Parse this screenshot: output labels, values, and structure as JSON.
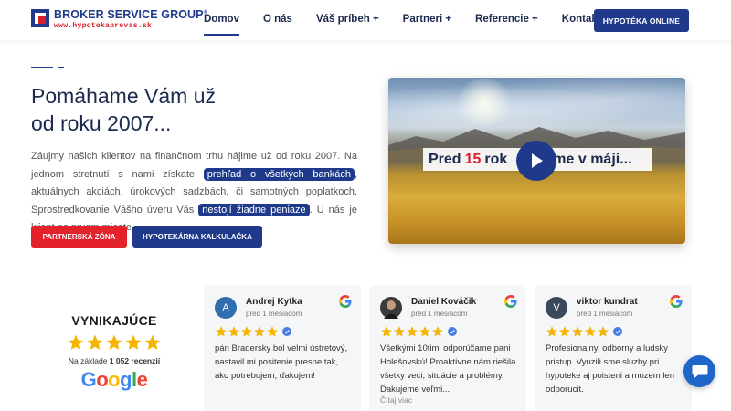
{
  "header": {
    "logo_title": "BROKER SERVICE GROUP",
    "logo_reg": "®",
    "logo_url": "www.hypotekaprevas.sk",
    "nav": [
      {
        "label": "Domov",
        "active": true
      },
      {
        "label": "O nás",
        "active": false
      },
      {
        "label": "Váš príbeh +",
        "active": false
      },
      {
        "label": "Partneri +",
        "active": false
      },
      {
        "label": "Referencie +",
        "active": false
      },
      {
        "label": "Kontakt",
        "active": false
      }
    ],
    "cta_label": "HYPOTÉKA ONLINE"
  },
  "hero": {
    "title_line1": "Pomáhame Vám už",
    "title_line2": "od roku 2007...",
    "text_part1": "Záujmy našich klientov na finančnom trhu hájime už od roku 2007. Na jednom stretnutí s nami získate ",
    "highlight1": "prehľad o všetkých bankách",
    "text_part2": ", aktuálnych akciách, úrokových sadzbách, či samotných poplatkoch. Sprostredkovanie Vášho úveru Vás ",
    "highlight2": "nestojí žiadne peniaze",
    "text_part3": ". U nás je klient na prvom mieste.",
    "btn_partner": "PARTNERSKÁ ZÓNA",
    "btn_calc": "HYPOTEKÁRNA KALKULAČKA"
  },
  "video": {
    "banner_pre": "Pred",
    "banner_num": "15",
    "banner_post": "rok",
    "banner_end": "me v máji..."
  },
  "reviews": {
    "summary_title": "VYNIKAJÚCE",
    "summary_prefix": "Na základe",
    "summary_count": "1 052 recenzií",
    "google_letters": [
      "G",
      "o",
      "o",
      "g",
      "l",
      "e"
    ],
    "items": [
      {
        "initial": "A",
        "name": "Andrej Kytka",
        "when": "pred 1 mesiacom",
        "text": "pán Bradersky bol velmi ústretový, nastavil mi positenie presne tak, ako potrebujem, ďakujem!",
        "more": "",
        "avatar_color": "#2f6fb0",
        "rating": 5
      },
      {
        "initial": "",
        "name": "Daniel Kováčik",
        "when": "pred 1 mesiacom",
        "text": "Všetkými 10timi odporúčame pani Holešovskú! Proaktívne nám riešila všetky veci, situácie a problémy. Ďakujeme veľmi...",
        "more": "Čítaj viac",
        "avatar_color": "#3a3a3a",
        "rating": 5
      },
      {
        "initial": "V",
        "name": "viktor kundrat",
        "when": "pred 1 mesiacom",
        "text": "Profesionalny, odborny a ludsky pristup. Vyuzili sme sluzby pri hypoteke aj poisteni a mozem len odporucit.",
        "more": "",
        "avatar_color": "#3b4a5a",
        "rating": 5
      }
    ]
  },
  "colors": {
    "brand_blue": "#1f3a8a",
    "brand_red": "#e3222c",
    "star_gold": "#f5b400",
    "chat_blue": "#1f66c9"
  }
}
